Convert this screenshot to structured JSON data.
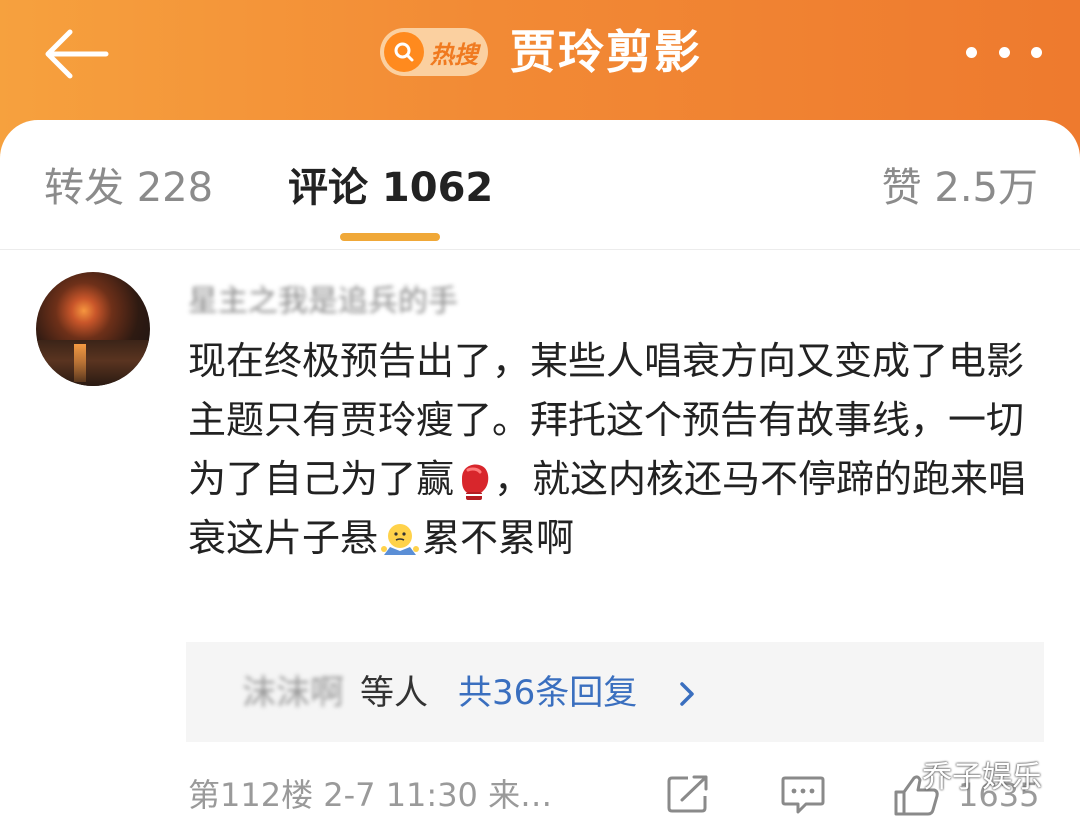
{
  "header": {
    "title": "贾玲剪影",
    "hot_search_label": "热搜",
    "back_icon": "back-arrow-icon",
    "more_icon": "more-dots-icon",
    "colors": {
      "gradient_start": "#f6a13e",
      "gradient_end": "#ee7a2e",
      "accent": "#f0a838",
      "link": "#3a6fbf"
    }
  },
  "tabs": {
    "repost": "转发 228",
    "comments": "评论 1062",
    "likes": "赞 2.5万",
    "active": "comments"
  },
  "comment": {
    "username": "星主之我是追兵的手",
    "text_parts": [
      "现在终极预告出了，某些人唱衰方向又变成了电影主题只有贾玲瘦了。拜托这个预告有故事线，一切为了自己为了赢",
      "，就这内核还马不停蹄的跑来唱衰这片子悬",
      "累不累啊"
    ],
    "emojis": [
      "boxing-glove-emoji",
      "shrug-emoji"
    ],
    "replies": {
      "names": "沫沫啊",
      "suffix": "等人",
      "count_label": "共36条回复"
    },
    "floor_and_time": "第112楼 2-7 11:30 来…",
    "like_count": "1635"
  },
  "watermark": "乔子娱乐"
}
